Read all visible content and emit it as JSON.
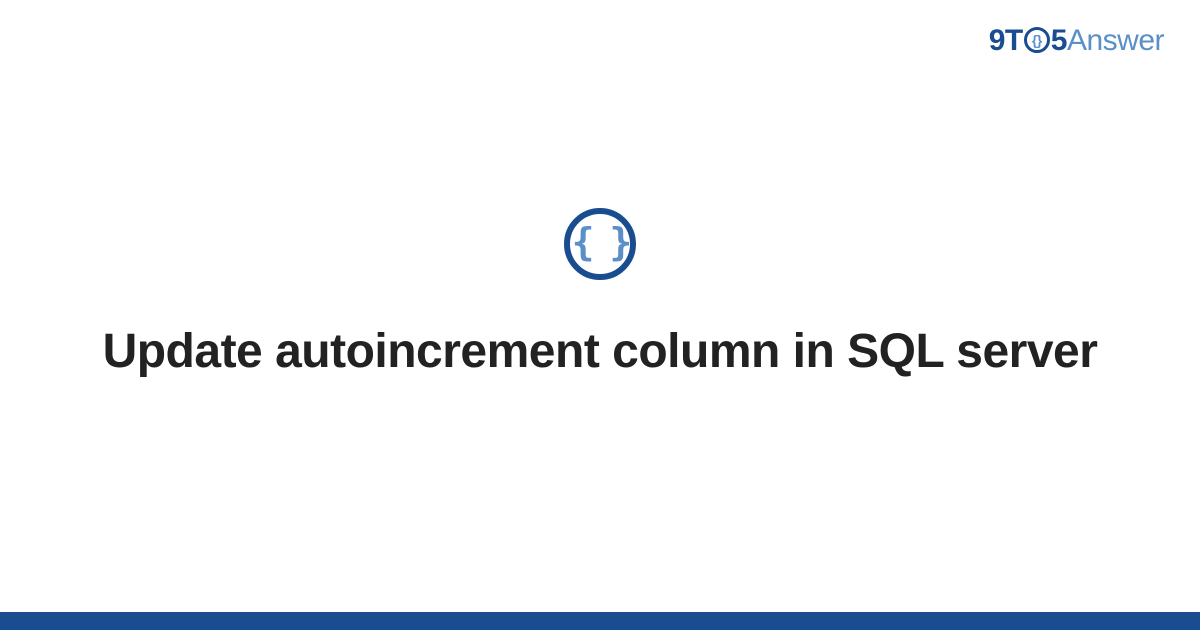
{
  "brand": {
    "part1": "9T",
    "clock": "{}",
    "part2": "5",
    "part3": "Answer"
  },
  "category": {
    "icon_glyph": "{ }",
    "icon_name": "code-braces-icon"
  },
  "title": "Update autoincrement column in SQL server",
  "colors": {
    "primary": "#1a4d8f",
    "secondary": "#5a8fc7"
  }
}
